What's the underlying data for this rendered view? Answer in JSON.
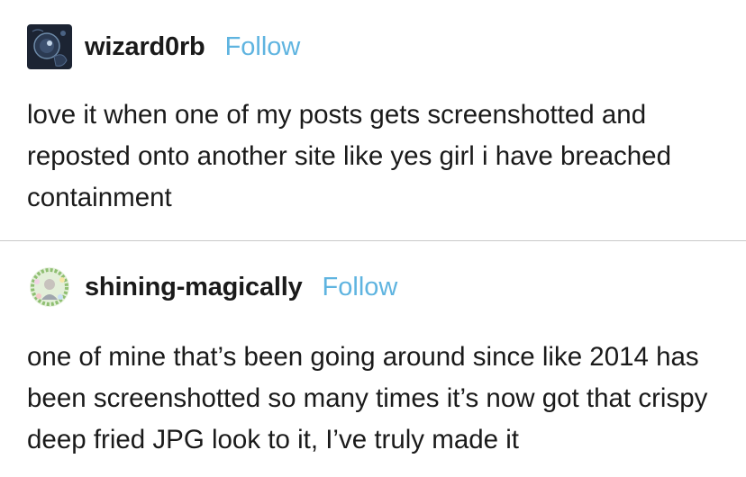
{
  "posts": [
    {
      "username": "wizard0rb",
      "follow_label": "Follow",
      "text": "love it when one of my posts gets screenshotted and reposted onto another site like yes girl i have breached containment"
    },
    {
      "username": "shining-magically",
      "follow_label": "Follow",
      "text": "one of mine that’s been going around since like 2014 has been screenshotted so many times it’s now got that crispy deep fried JPG look to it, I’ve truly made it"
    }
  ],
  "colors": {
    "follow": "#5fb4e0",
    "divider": "#c9c9c9",
    "text": "#1a1a1a"
  }
}
